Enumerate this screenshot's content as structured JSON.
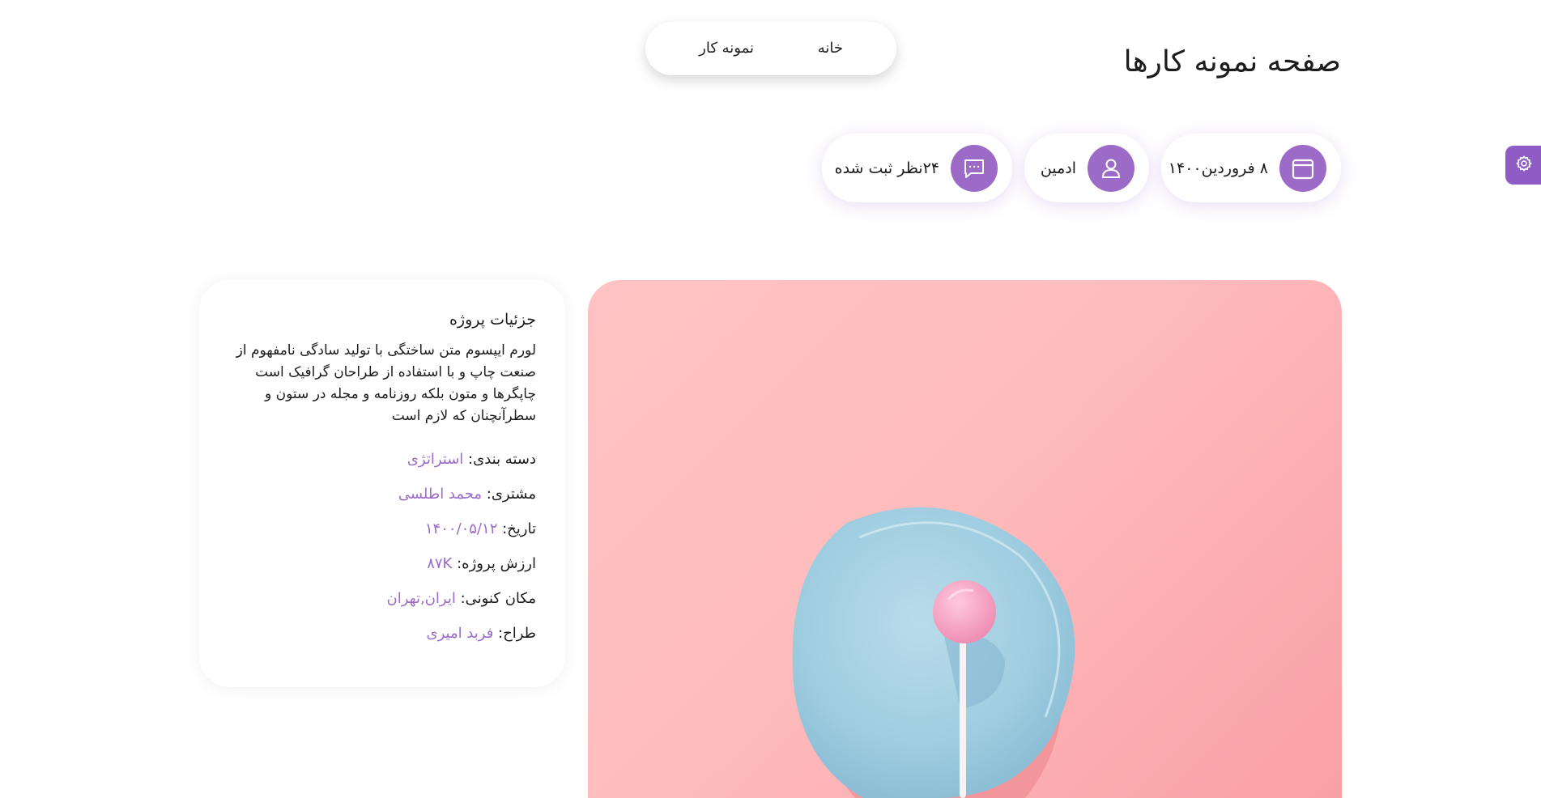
{
  "nav": {
    "home_label": "خانه",
    "portfolio_label": "نمونه کار"
  },
  "page": {
    "title": "صفحه نمونه کارها"
  },
  "meta": {
    "date": "۸ فروردین۱۴۰۰",
    "author": "ادمین",
    "comments": "۲۴نظر ثبت شده"
  },
  "details": {
    "title": "جزئیات پروژه",
    "description": "لورم ایپسوم متن ساختگی با تولید سادگی نامفهوم از صنعت چاپ و با استفاده از طراحان گرافیک است چاپگرها و متون بلکه روزنامه و مجله در ستون و سطرآنچنان که لازم است",
    "rows": [
      {
        "label": "دسته بندی:",
        "value": "استراتژی"
      },
      {
        "label": "مشتری:",
        "value": "محمد اطلسی"
      },
      {
        "label": "تاریخ:",
        "value": "۱۴۰۰/۰۵/۱۲"
      },
      {
        "label": "ارزش پروژه:",
        "value": "۸۷K"
      },
      {
        "label": "مکان کنونی:",
        "value": "ایران,تهران"
      },
      {
        "label": "طراح:",
        "value": "فربد امیری"
      }
    ]
  },
  "icons": {
    "calendar": "calendar-icon",
    "user": "user-icon",
    "comments": "chat-bubble-icon",
    "settings": "gear-icon"
  },
  "colors": {
    "accent": "#9b6bc7",
    "hero_background": "#ffbcbd",
    "plate": "#9fcde0",
    "lollipop": "#f59fc0"
  }
}
